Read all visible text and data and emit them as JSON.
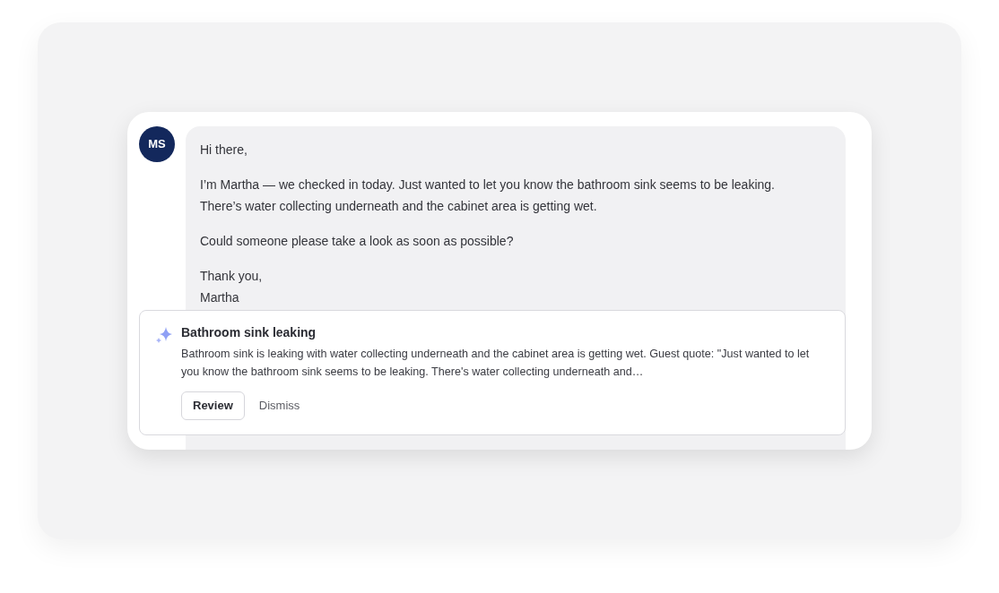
{
  "message": {
    "avatar_initials": "MS",
    "paragraphs": [
      [
        "Hi there,"
      ],
      [
        "I’m Martha — we checked in today. Just wanted to let you know the bathroom sink seems to be leaking.",
        "There’s water collecting underneath and the cabinet area is getting wet."
      ],
      [
        "Could someone please take a look as soon as possible?"
      ],
      [
        "Thank you,",
        "Martha"
      ]
    ]
  },
  "suggestion": {
    "title": "Bathroom sink leaking",
    "description": "Bathroom sink is leaking with water collecting underneath and the cabinet area is getting wet. Guest quote: \"Just wanted to let you know the bathroom sink seems to be leaking. There's water collecting underneath and…",
    "buttons": [
      {
        "label": "Review",
        "kind": "outline"
      },
      {
        "label": "Dismiss",
        "kind": "text"
      }
    ]
  }
}
